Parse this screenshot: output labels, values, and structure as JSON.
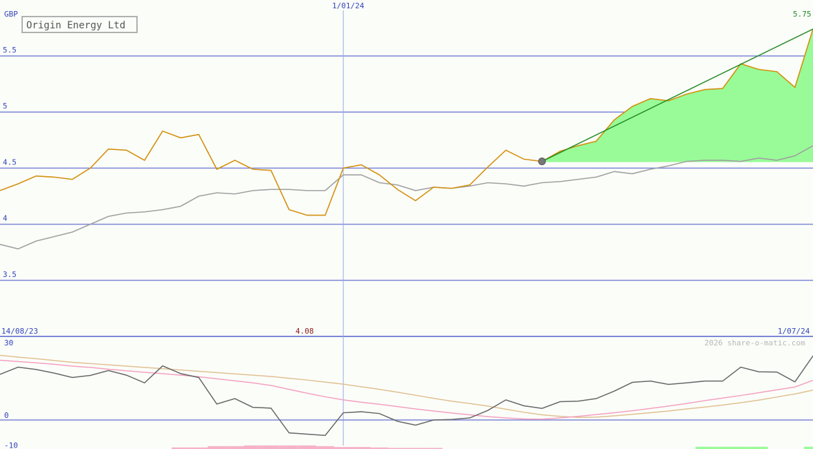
{
  "chart_data": [
    {
      "type": "line",
      "title": "Origin Energy Ltd",
      "ylabel": "GBP",
      "currency_label": "GBP",
      "ylim": [
        3.0,
        5.75
      ],
      "yticks": [
        "5.5",
        "5",
        "4.5",
        "4",
        "3.5"
      ],
      "ytick_values": [
        5.5,
        5.0,
        4.5,
        4.0,
        3.5
      ],
      "x_start_label": "14/08/23",
      "x_mid_label": "1/01/24",
      "x_end_label": "1/07/24",
      "x_mid_index": 19,
      "min_label": "4.08",
      "max_label": "5.75",
      "trend_start_index": 30,
      "trend_start_value": 4.56,
      "trend_end_value": 5.74,
      "series": [
        {
          "values": [
            4.3,
            4.36,
            4.43,
            4.42,
            4.4,
            4.5,
            4.67,
            4.66,
            4.57,
            4.83,
            4.77,
            4.8,
            4.49,
            4.57,
            4.49,
            4.48,
            4.13,
            4.08,
            4.08,
            4.5,
            4.53,
            4.44,
            4.31,
            4.21,
            4.33,
            4.32,
            4.35,
            4.51,
            4.66,
            4.58,
            4.56,
            4.65,
            4.7,
            4.74,
            4.93,
            5.05,
            5.12,
            5.1,
            5.16,
            5.2,
            5.21,
            5.43,
            5.38,
            5.36,
            5.22,
            5.74
          ],
          "color": "#d4900e"
        },
        {
          "values": [
            3.82,
            3.78,
            3.85,
            3.89,
            3.93,
            4.0,
            4.07,
            4.1,
            4.11,
            4.13,
            4.16,
            4.25,
            4.28,
            4.27,
            4.3,
            4.31,
            4.31,
            4.3,
            4.3,
            4.44,
            4.44,
            4.37,
            4.35,
            4.3,
            4.33,
            4.32,
            4.34,
            4.37,
            4.36,
            4.34,
            4.37,
            4.38,
            4.4,
            4.42,
            4.47,
            4.45,
            4.49,
            4.52,
            4.56,
            4.57,
            4.57,
            4.56,
            4.59,
            4.57,
            4.61,
            4.7
          ],
          "color": "#a0a0a0"
        }
      ],
      "colors": {
        "price": "#d4900e",
        "trend": "#228b22",
        "fill": "#98fb98",
        "grid": "#7b87d6",
        "axis_text": "#3344bb"
      }
    },
    {
      "type": "line",
      "ylim": [
        -10,
        30
      ],
      "yticks": [
        "30",
        "0",
        "-10"
      ],
      "ytick_values": [
        30,
        0,
        -10
      ],
      "watermark": "2026 share-o-matic.com",
      "series": [
        {
          "values": [
            17.7,
            20.5,
            19.6,
            18.2,
            16.5,
            17.3,
            19.2,
            17.4,
            14.4,
            21.0,
            18.0,
            16.5,
            6.2,
            8.3,
            4.9,
            4.6,
            -5.0,
            -5.5,
            -6.0,
            2.8,
            3.2,
            2.5,
            -0.5,
            -2.0,
            0.0,
            0.2,
            0.8,
            3.7,
            7.8,
            5.5,
            4.5,
            7.1,
            7.3,
            8.3,
            11.2,
            14.6,
            15.1,
            13.8,
            14.4,
            15.1,
            15.1,
            20.5,
            18.7,
            18.6,
            14.8,
            24.9
          ],
          "color": "#666666"
        },
        {
          "values": [
            23.2,
            22.7,
            22.2,
            21.6,
            20.9,
            20.4,
            19.7,
            19.1,
            18.5,
            18.0,
            17.4,
            16.8,
            16.0,
            15.2,
            14.4,
            13.4,
            11.9,
            10.4,
            9.0,
            7.8,
            6.9,
            6.1,
            5.2,
            4.3,
            3.5,
            2.7,
            2.0,
            1.3,
            0.8,
            0.4,
            0.3,
            0.8,
            1.4,
            2.1,
            2.8,
            3.6,
            4.5,
            5.4,
            6.4,
            7.5,
            8.5,
            9.5,
            10.6,
            11.7,
            12.8,
            15.4
          ],
          "color": "#f4a0c0"
        },
        {
          "values": [
            25.1,
            24.4,
            23.8,
            23.1,
            22.4,
            21.9,
            21.4,
            20.9,
            20.4,
            19.9,
            19.4,
            18.9,
            18.4,
            17.9,
            17.4,
            16.9,
            16.2,
            15.5,
            14.7,
            13.9,
            12.9,
            11.9,
            10.8,
            9.6,
            8.4,
            7.3,
            6.4,
            5.4,
            4.2,
            3.0,
            2.0,
            1.4,
            1.0,
            1.1,
            1.6,
            2.2,
            2.8,
            3.5,
            4.3,
            5.0,
            5.8,
            6.7,
            7.7,
            8.9,
            10.1,
            11.6
          ],
          "color": "#e0c090"
        }
      ],
      "histogram": {
        "pink": [
          0,
          0,
          0,
          0,
          0,
          0,
          0,
          0,
          0,
          0,
          -0.7,
          -0.7,
          -1.3,
          -1.3,
          -1.6,
          -1.6,
          -1.6,
          -1.6,
          -1.3,
          -0.9,
          -0.9,
          -0.7,
          -0.5,
          -0.5,
          -0.5,
          0,
          0,
          0,
          0,
          0,
          0,
          0,
          0,
          0,
          0,
          0,
          0,
          0,
          0,
          0,
          0,
          0,
          0,
          0,
          0,
          0
        ],
        "green": [
          0,
          0,
          0,
          0,
          0,
          0,
          0,
          0,
          0,
          0,
          0,
          0,
          0,
          0,
          0,
          0,
          0,
          0,
          0,
          0,
          0,
          0,
          0,
          0,
          0,
          0,
          0,
          0,
          0,
          0,
          0,
          0,
          0,
          0,
          0,
          0,
          0,
          0,
          0,
          0.7,
          0.7,
          0.7,
          0.7,
          0,
          0,
          0.7
        ]
      }
    }
  ]
}
